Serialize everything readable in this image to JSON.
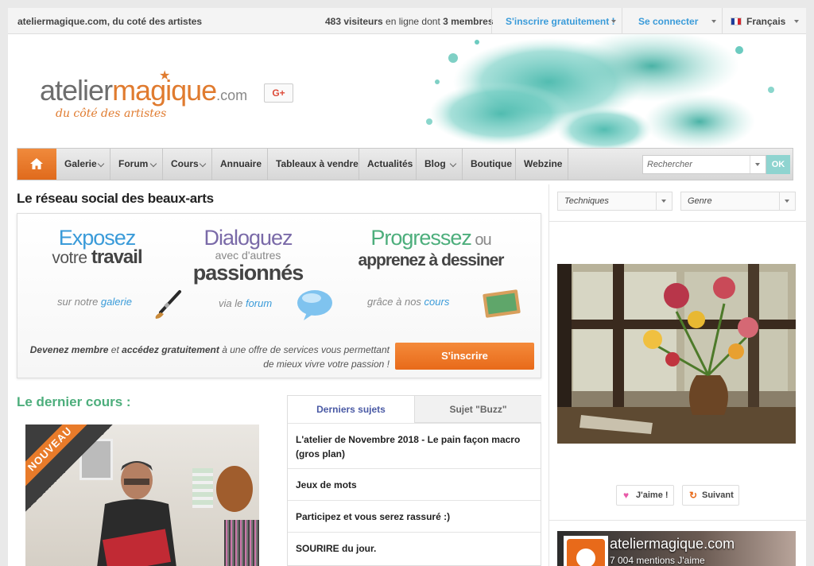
{
  "topbar": {
    "site_name": "ateliermagique.com, du coté des artistes",
    "visitors_count": "483 visiteurs",
    "visitors_text": " en ligne dont ",
    "members_count": "3 membres",
    "register_label": "S'inscrire gratuitement !",
    "login_label": "Se connecter",
    "language_label": "Français"
  },
  "header": {
    "logo_atelier": "atelier",
    "logo_magique": "magique",
    "logo_com": ".com",
    "tagline": "du côté des artistes",
    "gplus_label": "G+"
  },
  "nav": {
    "items": [
      {
        "label": "Galerie"
      },
      {
        "label": "Forum"
      },
      {
        "label": "Cours"
      },
      {
        "label": "Annuaire"
      },
      {
        "label": "Tableaux à vendre"
      },
      {
        "label": "Actualités"
      },
      {
        "label": "Blog"
      },
      {
        "label": "Boutique"
      },
      {
        "label": "Webzine"
      }
    ],
    "search_placeholder": "Rechercher",
    "ok_label": "OK"
  },
  "main": {
    "title": "Le réseau social des beaux-arts",
    "promo": {
      "col1": {
        "big": "Exposez",
        "mid": "votre",
        "strong": "travail",
        "sub_prefix": "sur notre ",
        "sub_link": "galerie"
      },
      "col2": {
        "big": "Dialoguez",
        "small": "avec d'autres",
        "strong": "passionnés",
        "sub_prefix": "via le ",
        "sub_link": "forum"
      },
      "col3": {
        "big": "Progressez",
        "ou": " ou",
        "strong": "apprenez à dessiner",
        "sub_prefix": "grâce à nos ",
        "sub_link": "cours"
      },
      "foot_b1": "Devenez membre",
      "foot_t1": " et ",
      "foot_b2": "accédez gratuitement",
      "foot_t2": " à une offre de services vous permettant de mieux vivre votre passion !",
      "button": "S'inscrire"
    },
    "last_course_title": "Le dernier cours :",
    "ribbon_label": "NOUVEAU",
    "topics": {
      "tabs": [
        "Derniers sujets",
        "Sujet \"Buzz\""
      ],
      "items": [
        "L'atelier de Novembre 2018 - Le pain façon macro (gros plan)",
        "Jeux de mots",
        "Participez et vous serez rassuré :)",
        "SOURIRE du jour."
      ]
    }
  },
  "sidebar": {
    "techniques_label": "Techniques",
    "genre_label": "Genre",
    "like_label": "J'aime !",
    "follow_label": "Suivant",
    "fb_name": "ateliermagique.com",
    "fb_likes": "7 004 mentions J'aime"
  },
  "colors": {
    "accent_orange": "#e86a1a",
    "link_blue": "#3a9bd9",
    "green": "#4dae7c",
    "purple": "#7a6aa8"
  }
}
